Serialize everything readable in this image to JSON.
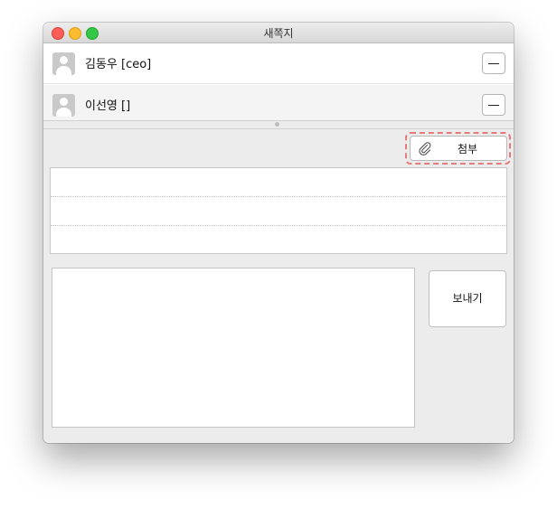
{
  "window": {
    "title": "새쪽지"
  },
  "recipients": [
    {
      "name": "김동우 [ceo]"
    },
    {
      "name": "이선영 []"
    }
  ],
  "attach": {
    "label": "첨부",
    "icon": "paperclip-icon"
  },
  "send": {
    "label": "보내기"
  },
  "colors": {
    "highlight": "#e57a7a",
    "close": "#fc5f57",
    "minimize": "#fdbc2e",
    "maximize": "#33c748"
  }
}
